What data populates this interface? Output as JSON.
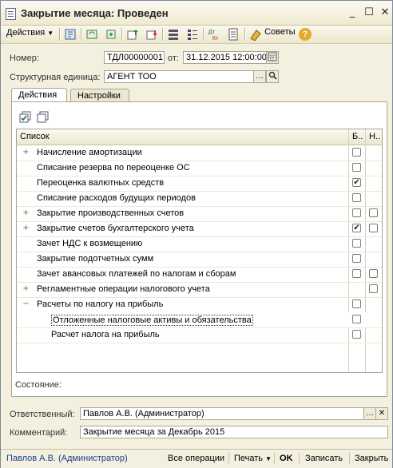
{
  "window": {
    "title": "Закрытие месяца: Проведен"
  },
  "toolbar": {
    "actions_label": "Действия",
    "tips_label": "Советы",
    "help_glyph": "?"
  },
  "header": {
    "number_label": "Номер:",
    "number_value": "ТДЛ00000001",
    "from_label": "от:",
    "date_value": "31.12.2015 12:00:00",
    "unit_label": "Структурная единица:",
    "unit_value": "АГЕНТ ТОО"
  },
  "tabs": [
    {
      "label": "Действия",
      "active": true
    },
    {
      "label": "Настройки",
      "active": false
    }
  ],
  "grid": {
    "col_list": "Список",
    "col_b": "Б..",
    "col_n": "Н..",
    "rows": [
      {
        "text": "Начисление амортизации",
        "expander": "+",
        "b": false,
        "n": null
      },
      {
        "text": "Списание резерва по переоценке ОС",
        "expander": "",
        "b": false,
        "n": null
      },
      {
        "text": "Переоценка валютных средств",
        "expander": "",
        "b": true,
        "n": null
      },
      {
        "text": "Списание расходов будущих периодов",
        "expander": "",
        "b": false,
        "n": null
      },
      {
        "text": "Закрытие производственных счетов",
        "expander": "+",
        "b": false,
        "n": false
      },
      {
        "text": "Закрытие счетов бухгалтерского учета",
        "expander": "+",
        "b": true,
        "n": false
      },
      {
        "text": "Зачет НДС к возмещению",
        "expander": "",
        "b": false,
        "n": null
      },
      {
        "text": "Закрытие подотчетных сумм",
        "expander": "",
        "b": false,
        "n": null
      },
      {
        "text": "Зачет авансовых платежей по налогам и сборам",
        "expander": "",
        "b": false,
        "n": false
      },
      {
        "text": "Регламентные операции налогового учета",
        "expander": "+",
        "b": null,
        "n": false
      },
      {
        "text": "Расчеты по налогу на прибыль",
        "expander": "−",
        "b": false,
        "n": null
      },
      {
        "text": "Отложенные налоговые активы и обязательства",
        "expander": "",
        "b": false,
        "n": null,
        "child": true,
        "selected": true
      },
      {
        "text": "Расчет налога на прибыль",
        "expander": "",
        "b": false,
        "n": null,
        "child": true
      }
    ]
  },
  "status_label": "Состояние:",
  "footer": {
    "responsible_label": "Ответственный:",
    "responsible_value": "Павлов А.В. (Администратор)",
    "comment_label": "Комментарий:",
    "comment_value": "Закрытие месяца за Декабрь 2015"
  },
  "bottom": {
    "user": "Павлов А.В. (Администратор)",
    "all_ops": "Все операции",
    "print": "Печать",
    "ok": "OK",
    "save": "Записать",
    "close": "Закрыть"
  }
}
